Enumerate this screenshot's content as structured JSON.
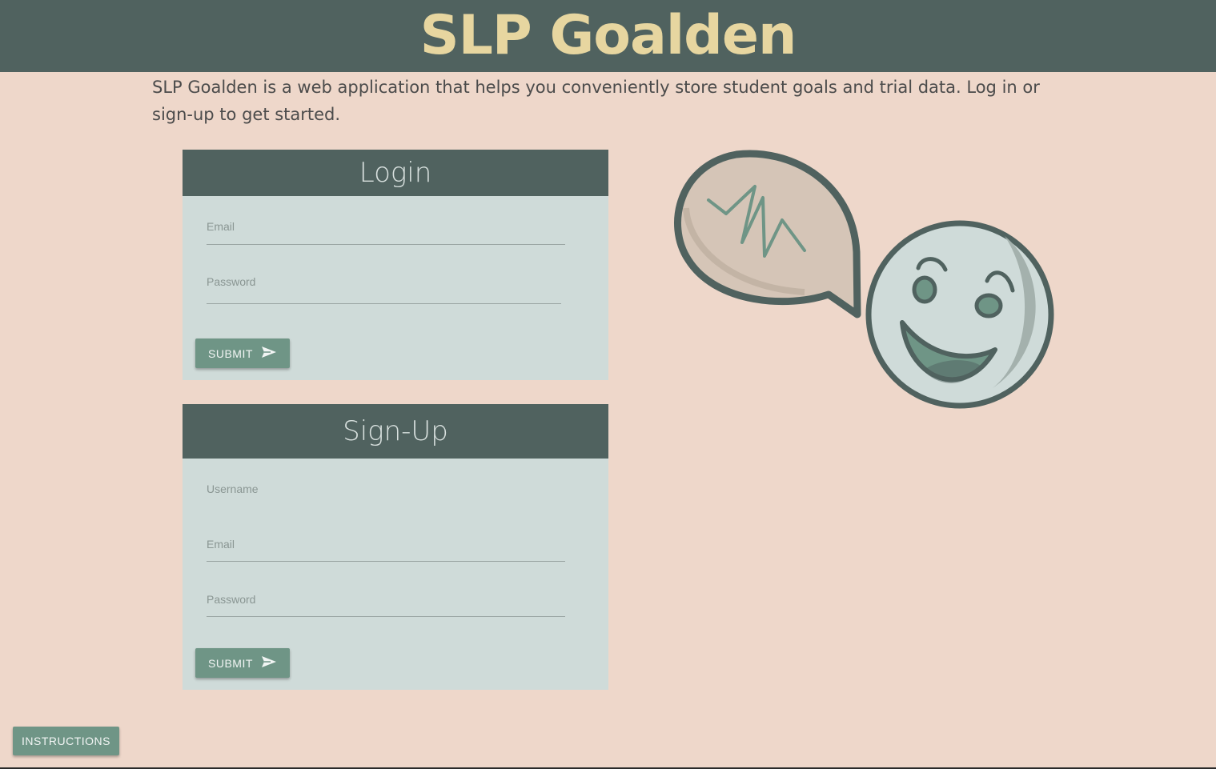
{
  "header": {
    "title": "SLP Goalden"
  },
  "intro": {
    "text": "SLP Goalden is a web application that helps you conveniently store student goals and trial data. Log in or sign-up to get started."
  },
  "login": {
    "title": "Login",
    "email_placeholder": "Email",
    "password_placeholder": "Password",
    "submit_label": "SUBMIT",
    "submit_icon": "send-icon"
  },
  "signup": {
    "title": "Sign-Up",
    "username_placeholder": "Username",
    "email_placeholder": "Email",
    "password_placeholder": "Password",
    "submit_label": "SUBMIT",
    "submit_icon": "send-icon"
  },
  "footer": {
    "instructions_label": "INSTRUCTIONS"
  },
  "colors": {
    "background": "#eed7ca",
    "header": "#50625f",
    "title": "#e7d6a0",
    "card": "#cfdbd9",
    "button": "#6f9586"
  },
  "illustration": {
    "name": "smiley-speech-bubble-illustration"
  }
}
